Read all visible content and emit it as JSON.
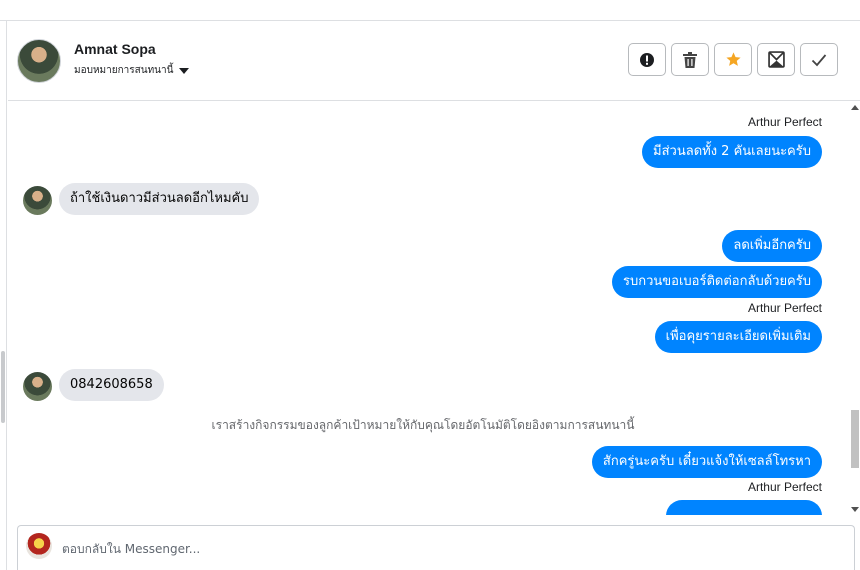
{
  "header": {
    "contact_name": "Amnat Sopa",
    "assign_label": "มอบหมายการสนทนานี้",
    "actions": [
      {
        "name": "spam-button",
        "icon": "exclamation-circle-icon"
      },
      {
        "name": "delete-button",
        "icon": "trash-icon"
      },
      {
        "name": "star-button",
        "icon": "star-icon",
        "color": "#f5a623"
      },
      {
        "name": "mark-unread-button",
        "icon": "envelope-icon"
      },
      {
        "name": "done-button",
        "icon": "check-icon"
      }
    ]
  },
  "messages": {
    "sender_1": "Arthur Perfect",
    "out_1": "มีส่วนลดทั้ง 2 คันเลยนะครับ",
    "in_1": "ถ้าใช้เงินดาวมีส่วนลดอีกไหมคับ",
    "out_2": "ลดเพิ่มอีกครับ",
    "out_3": "รบกวนขอเบอร์ติดต่อกลับด้วยครับ",
    "sender_2": "Arthur Perfect",
    "out_4": "เพื่อคุยรายละเอียดเพิ่มเติม",
    "in_2": "0842608658",
    "system_note": "เราสร้างกิจกรรมของลูกค้าเป้าหมายให้กับคุณโดยอัตโนมัติโดยอิงตามการสนทนานี้",
    "out_5": "สักครู่นะครับ เดี๋ยวแจ้งให้เซลล์โทรหา",
    "sender_3": "Arthur Perfect"
  },
  "composer": {
    "placeholder": "ตอบกลับใน Messenger..."
  },
  "colors": {
    "outgoing_bubble": "#0084ff",
    "incoming_bubble": "#e4e6eb",
    "star": "#f5a623"
  }
}
